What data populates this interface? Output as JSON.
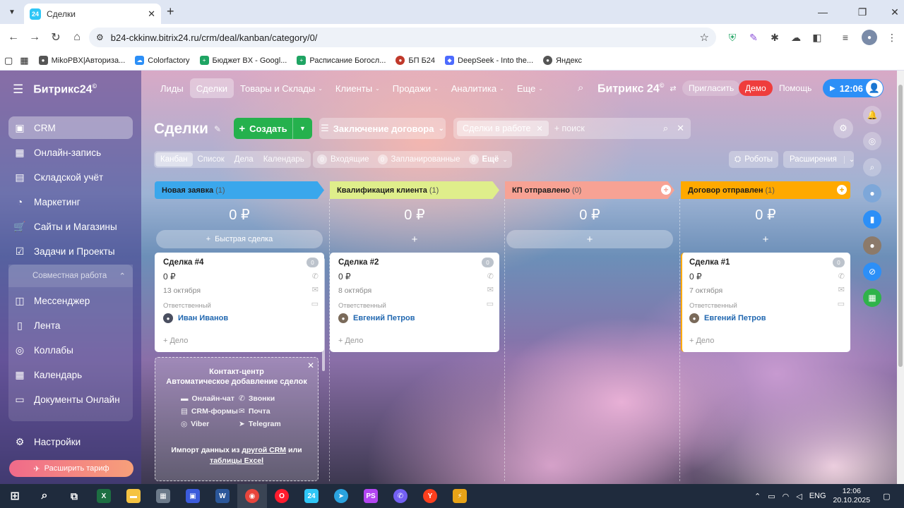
{
  "browser": {
    "tab_title": "Сделки",
    "favicon_text": "24",
    "url": "b24-ckkinw.bitrix24.ru/crm/deal/kanban/category/0/"
  },
  "bookmarks": [
    {
      "label": "MikoPBX|Авториза...",
      "color": "#555555"
    },
    {
      "label": "Colorfactory",
      "color": "#2c8ff7"
    },
    {
      "label": "Бюджет BX - Googl...",
      "color": "#1fa463"
    },
    {
      "label": "Расписание Богосл...",
      "color": "#1fa463"
    },
    {
      "label": "БП Б24",
      "color": "#c0392b"
    },
    {
      "label": "DeepSeek - Into the...",
      "color": "#4d6bfe"
    },
    {
      "label": "Яндекс",
      "color": "#555555"
    }
  ],
  "sidebar": {
    "logo": "Битрикс24",
    "logo_sup": "©",
    "items": [
      {
        "label": "CRM",
        "icon": "▣",
        "active": true
      },
      {
        "label": "Онлайн-запись",
        "icon": "▦"
      },
      {
        "label": "Складской учёт",
        "icon": "▤"
      },
      {
        "label": "Маркетинг",
        "icon": "◔"
      },
      {
        "label": "Сайты и Магазины",
        "icon": "🛒"
      },
      {
        "label": "Задачи и Проекты",
        "icon": "☑"
      }
    ],
    "group_label": "Совместная работа",
    "group_items": [
      {
        "label": "Мессенджер",
        "icon": "◫"
      },
      {
        "label": "Лента",
        "icon": "▯"
      },
      {
        "label": "Коллабы",
        "icon": "◎"
      },
      {
        "label": "Календарь",
        "icon": "▦"
      },
      {
        "label": "Документы Онлайн",
        "icon": "▭"
      }
    ],
    "settings": "Настройки",
    "upgrade": "Расширить тариф"
  },
  "topmenu": [
    {
      "label": "Лиды",
      "chev": false
    },
    {
      "label": "Сделки",
      "chev": false,
      "active": true
    },
    {
      "label": "Товары и Склады",
      "chev": true
    },
    {
      "label": "Клиенты",
      "chev": true
    },
    {
      "label": "Продажи",
      "chev": true
    },
    {
      "label": "Аналитика",
      "chev": true
    },
    {
      "label": "Еще",
      "chev": true
    }
  ],
  "header": {
    "brand": "Битрикс 24",
    "brand_sup": "©",
    "invite": "Пригласить",
    "demo": "Демо",
    "help": "Помощь",
    "time": "12:06"
  },
  "toolbar": {
    "title": "Сделки",
    "create": "Создать",
    "contract": "Заключение договора",
    "filter_chip": "Сделки в работе",
    "search_placeholder": "+ поиск",
    "views": [
      "Канбан",
      "Список",
      "Дела",
      "Календарь"
    ],
    "counters": [
      {
        "n": "0",
        "label": "Входящие"
      },
      {
        "n": "0",
        "label": "Запланированные"
      },
      {
        "n": "0",
        "label": "Ещё"
      }
    ],
    "robots": "Роботы",
    "extensions": "Расширения"
  },
  "columns": [
    {
      "name": "Новая заявка",
      "count": "(1)",
      "color": "#3aa7ec",
      "sum": "0 ₽",
      "button": "Быстрая сделка",
      "card": {
        "title": "Сделка #4",
        "sum": "0 ₽",
        "date": "13 октября",
        "resp_label": "Ответственный",
        "user": "Иван Иванов",
        "activity": "+ Дело",
        "badge": "0"
      }
    },
    {
      "name": "Квалификация клиента",
      "count": "(1)",
      "color": "#dfee8b",
      "sum": "0 ₽",
      "button": "",
      "card": {
        "title": "Сделка #2",
        "sum": "0 ₽",
        "date": "8 октября",
        "resp_label": "Ответственный",
        "user": "Евгений Петров",
        "activity": "+ Дело",
        "badge": "0"
      }
    },
    {
      "name": "КП отправлено",
      "count": "(0)",
      "color": "#f7a294",
      "sum": "0 ₽",
      "button": ""
    },
    {
      "name": "Договор отправлен",
      "count": "(1)",
      "color": "#ffa900",
      "sum": "0 ₽",
      "button": "",
      "card": {
        "title": "Сделка #1",
        "sum": "0 ₽",
        "date": "7 октября",
        "resp_label": "Ответственный",
        "user": "Евгений Петров",
        "activity": "+ Дело",
        "badge": "0"
      }
    }
  ],
  "contact_center": {
    "title": "Контакт-центр",
    "subtitle": "Автоматическое добавление сделок",
    "channels": [
      "Онлайн-чат",
      "Звонки",
      "CRM-формы",
      "Почта",
      "Viber",
      "Telegram"
    ],
    "import_text": "Импорт данных из",
    "link1": "другой CRM",
    "or": "или",
    "link2": "таблицы Excel"
  },
  "tray": {
    "lang": "ENG",
    "time": "12:06",
    "date": "20.10.2025"
  }
}
